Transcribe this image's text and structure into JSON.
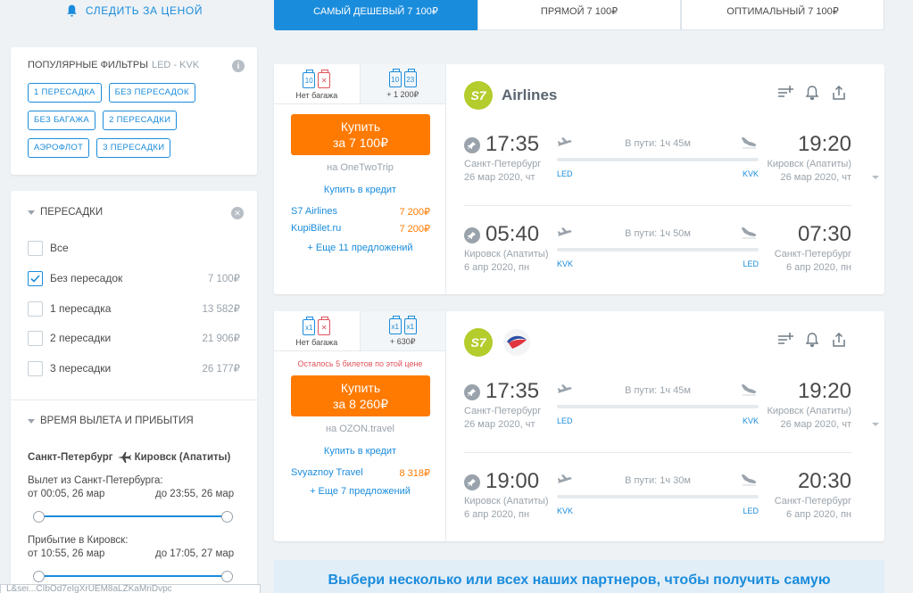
{
  "watch_price": {
    "label": "СЛЕДИТЬ ЗА ЦЕНОЙ",
    "icon": "bell-icon"
  },
  "sort_tabs": [
    {
      "label": "САМЫЙ ДЕШЕВЫЙ 7 100₽",
      "active": true
    },
    {
      "label": "ПРЯМОЙ 7 100₽",
      "active": false
    },
    {
      "label": "ОПТИМАЛЬНЫЙ 7 100₽",
      "active": false
    }
  ],
  "popular_filters": {
    "title": "ПОПУЛЯРНЫЕ ФИЛЬТРЫ",
    "route": "LED - KVK",
    "info": "i",
    "chips": [
      "1 ПЕРЕСАДКА",
      "БЕЗ ПЕРЕСАДОК",
      "БЕЗ БАГАЖА",
      "2 ПЕРЕСАДКИ",
      "АЭРОФЛОТ",
      "3 ПЕРЕСАДКИ"
    ]
  },
  "stops_filter": {
    "title": "ПЕРЕСАДКИ",
    "clear": "✕",
    "options": [
      {
        "label": "Все",
        "price": "",
        "checked": false
      },
      {
        "label": "Без пересадок",
        "price": "7 100₽",
        "checked": true
      },
      {
        "label": "1 пересадка",
        "price": "13 582₽",
        "checked": false
      },
      {
        "label": "2 пересадки",
        "price": "21 906₽",
        "checked": false
      },
      {
        "label": "3 пересадки",
        "price": "26 177₽",
        "checked": false
      }
    ]
  },
  "time_filter": {
    "title": "ВРЕМЯ ВЫЛЕТА И ПРИБЫТИЯ",
    "route_from": "Санкт-Петербург",
    "route_to": "Кировск (Апатиты)",
    "departure_label": "Вылет из Санкт-Петербурга:",
    "departure_from": "от 00:05, 26 мар",
    "departure_to": "до 23:55, 26 мар",
    "arrival_label": "Прибытие в Кировск:",
    "arrival_from": "от 10:55, 26 мар",
    "arrival_to": "до 17:05, 27 мар"
  },
  "hash_field": "L&sei...CIbOd7eIgXrUEM8aLZKaMriDvpc",
  "tickets": [
    {
      "bag_tabs": [
        {
          "icons": [
            "10",
            "✕"
          ],
          "label": "Нет багажа"
        },
        {
          "icons": [
            "10",
            "23"
          ],
          "label": "+ 1 200₽"
        }
      ],
      "warning": "",
      "buy_line1": "Купить",
      "buy_line2": "за 7 100₽",
      "seller": "на OneTwoTrip",
      "credit": "Купить в кредит",
      "offers": [
        {
          "name": "S7 Airlines",
          "price": "7 200₽"
        },
        {
          "name": "KupiBilet.ru",
          "price": "7 200₽"
        }
      ],
      "more": "+ Еще 11 предложений",
      "airline": "Airlines",
      "segments": [
        {
          "dep_time": "17:35",
          "dep_city": "Санкт-Петербург",
          "dep_date": "26 мар 2020, чт",
          "dep_iata": "LED",
          "duration": "В пути: 1ч 45м",
          "arr_time": "19:20",
          "arr_city": "Кировск (Апатиты)",
          "arr_date": "26 мар 2020, чт",
          "arr_iata": "KVK"
        },
        {
          "dep_time": "05:40",
          "dep_city": "Кировск (Апатиты)",
          "dep_date": "6 апр 2020, пн",
          "dep_iata": "KVK",
          "duration": "В пути: 1ч 50м",
          "arr_time": "07:30",
          "arr_city": "Санкт-Петербург",
          "arr_date": "6 апр 2020, пн",
          "arr_iata": "LED"
        }
      ]
    },
    {
      "bag_tabs": [
        {
          "icons": [
            "x1",
            "✕"
          ],
          "label": "Нет багажа"
        },
        {
          "icons": [
            "x1",
            "x1"
          ],
          "label": "+ 630₽"
        }
      ],
      "warning": "Осталось 5 билетов по этой цене",
      "buy_line1": "Купить",
      "buy_line2": "за 8 260₽",
      "seller": "на OZON.travel",
      "credit": "Купить в кредит",
      "offers": [
        {
          "name": "Svyaznoy Travel",
          "price": "8 318₽"
        }
      ],
      "more": "+ Еще 7 предложений",
      "airline": "",
      "segments": [
        {
          "dep_time": "17:35",
          "dep_city": "Санкт-Петербург",
          "dep_date": "26 мар 2020, чт",
          "dep_iata": "LED",
          "duration": "В пути: 1ч 45м",
          "arr_time": "19:20",
          "arr_city": "Кировск (Апатиты)",
          "arr_date": "26 мар 2020, чт",
          "arr_iata": "KVK"
        },
        {
          "dep_time": "19:00",
          "dep_city": "Кировск (Апатиты)",
          "dep_date": "6 апр 2020, пн",
          "dep_iata": "KVK",
          "duration": "В пути: 1ч 30м",
          "arr_time": "20:30",
          "arr_city": "Санкт-Петербург",
          "arr_date": "6 апр 2020, пн",
          "arr_iata": "LED"
        }
      ]
    }
  ],
  "logo_letters": "S7",
  "promo": "Выбери несколько или всех наших партнеров, чтобы получить самую",
  "colors": {
    "accent": "#1a8cdc",
    "buy": "#ff7a00",
    "s7": "#b4cc2c",
    "warning": "#e0525b"
  }
}
